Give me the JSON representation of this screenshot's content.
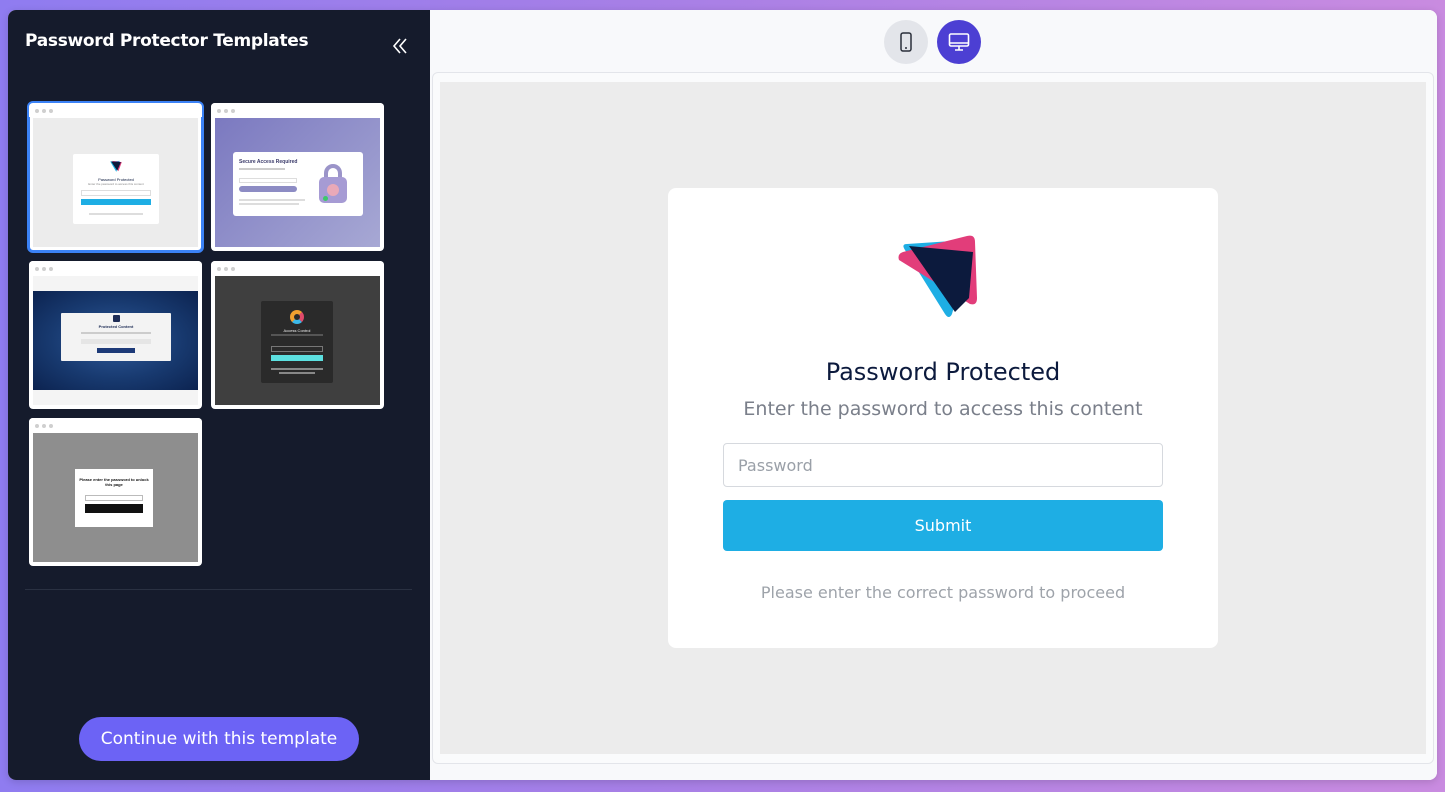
{
  "sidebar": {
    "title": "Password Protector Templates",
    "continue_label": "Continue with this template",
    "templates": [
      {
        "heading": "Password Protected",
        "sub": "Enter the password to access this content",
        "selected": true
      },
      {
        "heading": "Secure Access Required"
      },
      {
        "heading": "Protected Content"
      },
      {
        "heading": "Access Control"
      },
      {
        "heading": "Please enter the password to unlock this page"
      }
    ]
  },
  "preview": {
    "title": "Password Protected",
    "subtitle": "Enter the password to access this content",
    "password_placeholder": "Password",
    "submit_label": "Submit",
    "note": "Please enter the correct password to proceed"
  },
  "colors": {
    "accent": "#6c63f5",
    "submit": "#1eaee4",
    "sidebar_bg": "#151b2c",
    "device_active": "#4c3fd3"
  },
  "icons": {
    "collapse": "double-chevron-left-icon",
    "mobile": "mobile-phone-icon",
    "desktop": "desktop-monitor-icon",
    "logo": "triangle-logo"
  }
}
